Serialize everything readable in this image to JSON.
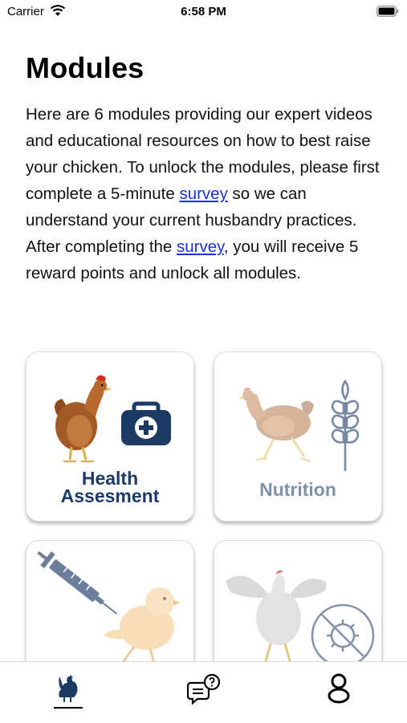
{
  "status_bar": {
    "carrier": "Carrier",
    "time": "6:58 PM"
  },
  "page": {
    "title": "Modules",
    "intro": {
      "part1": "Here are 6 modules providing our expert videos and educational resources on how to best raise your chicken. To unlock the modules, please first complete a 5-minute ",
      "link1": "survey",
      "part2": " so we can understand your current husbandry practices. After completing the ",
      "link2": "survey",
      "part3": ", you will receive 5 reward points and unlock all modules."
    }
  },
  "modules": [
    {
      "line1": "Health",
      "line2": "Assesment",
      "icon": "medical-kit-icon",
      "locked": false
    },
    {
      "label": "Nutrition",
      "icon": "wheat-icon",
      "locked": true
    },
    {
      "label": "",
      "icon": "syringe-icon",
      "locked": true
    },
    {
      "label": "",
      "icon": "no-virus-icon",
      "locked": true
    }
  ],
  "tab_bar": {
    "tabs": [
      {
        "icon": "rooster-icon",
        "active": true
      },
      {
        "icon": "chat-question-icon",
        "active": false
      },
      {
        "icon": "profile-icon",
        "active": false
      }
    ]
  },
  "colors": {
    "link": "#1a33d6",
    "card_label": "#1d3a64",
    "card_label_locked": "#7f8fa5",
    "icon_navy": "#1d3a64"
  }
}
